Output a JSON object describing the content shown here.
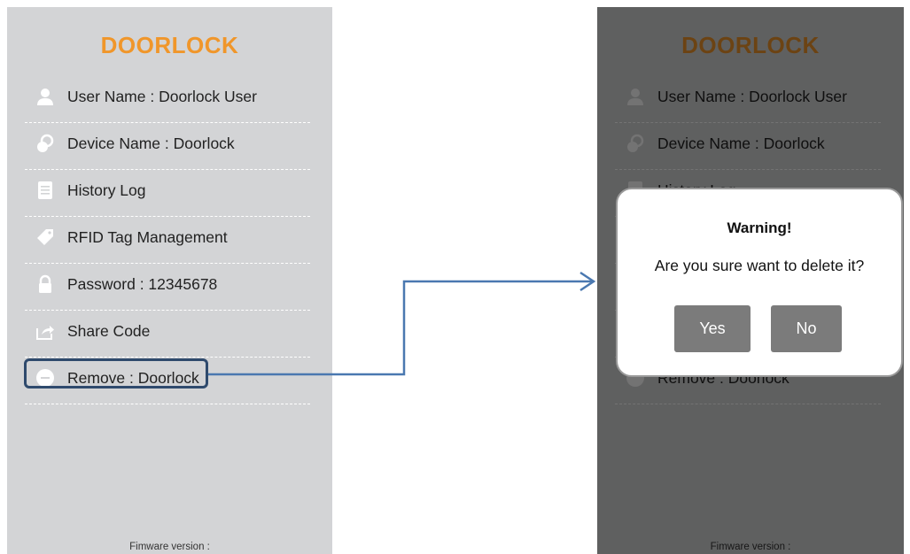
{
  "app": {
    "title": "DOORLOCK",
    "accent_color": "#f0962a"
  },
  "menu": {
    "items": [
      {
        "label": "User Name : Doorlock User",
        "icon": "user-icon"
      },
      {
        "label": "Device Name : Doorlock",
        "icon": "lock-icon"
      },
      {
        "label": "History Log",
        "icon": "document-icon"
      },
      {
        "label": "RFID Tag Management",
        "icon": "tag-icon"
      },
      {
        "label": "Password : 12345678",
        "icon": "padlock-icon"
      },
      {
        "label": "Share Code",
        "icon": "share-icon"
      },
      {
        "label": "Remove : Doorlock",
        "icon": "minus-circle-icon"
      }
    ]
  },
  "footer": {
    "firmware_label": "Fimware version :"
  },
  "dialog": {
    "title": "Warning!",
    "message": "Are you sure want to delete it?",
    "yes_label": "Yes",
    "no_label": "No"
  },
  "annotation": {
    "highlight_color": "#2f4a6d",
    "arrow_color": "#4a78b0"
  }
}
